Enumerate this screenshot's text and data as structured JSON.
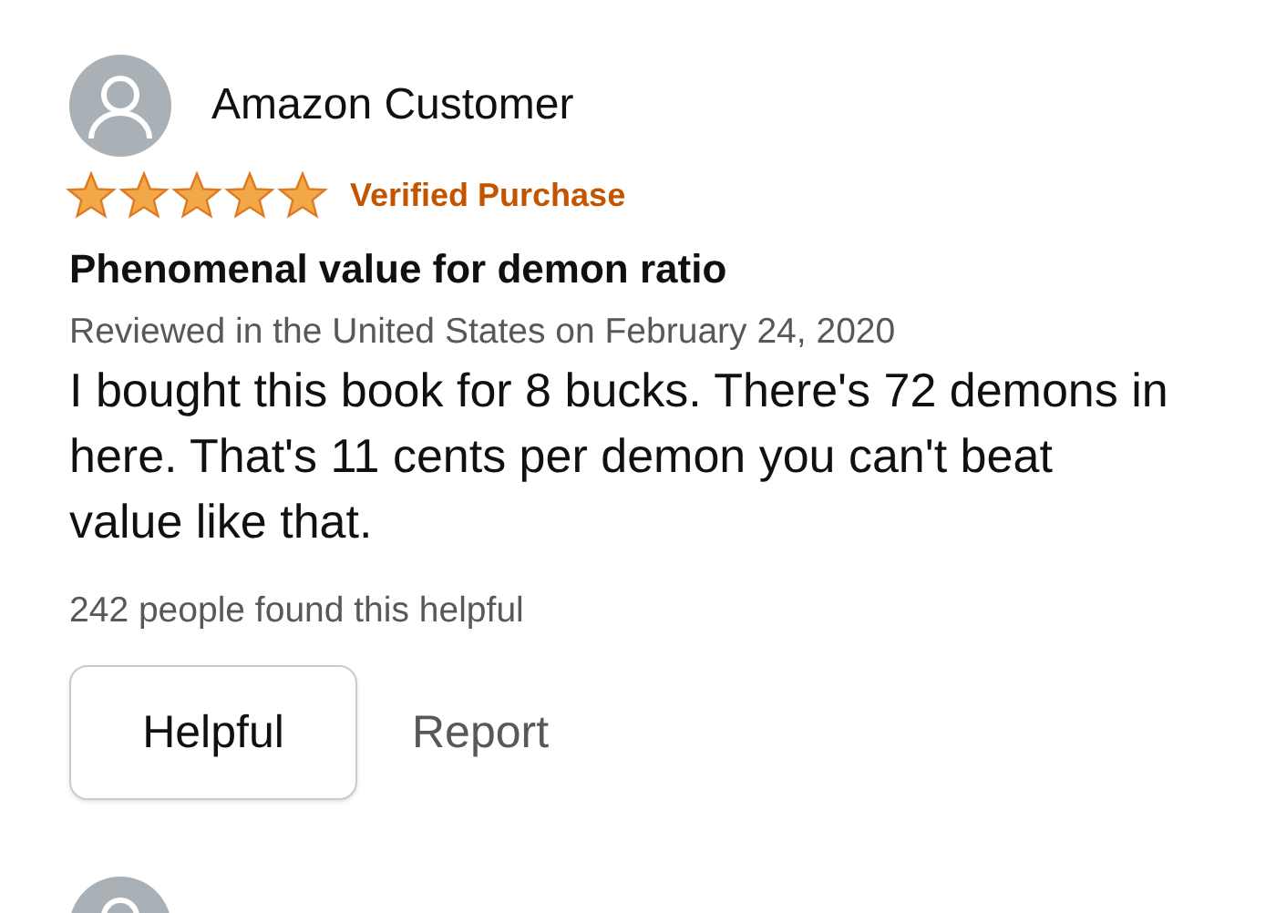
{
  "review": {
    "reviewer": "Amazon Customer",
    "stars": 5,
    "badge": "Verified Purchase",
    "title": "Phenomenal value for demon ratio",
    "meta": "Reviewed in the United States on February 24, 2020",
    "body": "I bought this book for 8 bucks. There's 72 demons in here. That's 11 cents per demon you can't beat value like that.",
    "helpful_count": "242 people found this helpful",
    "buttons": [
      "Helpful",
      "Report"
    ]
  }
}
